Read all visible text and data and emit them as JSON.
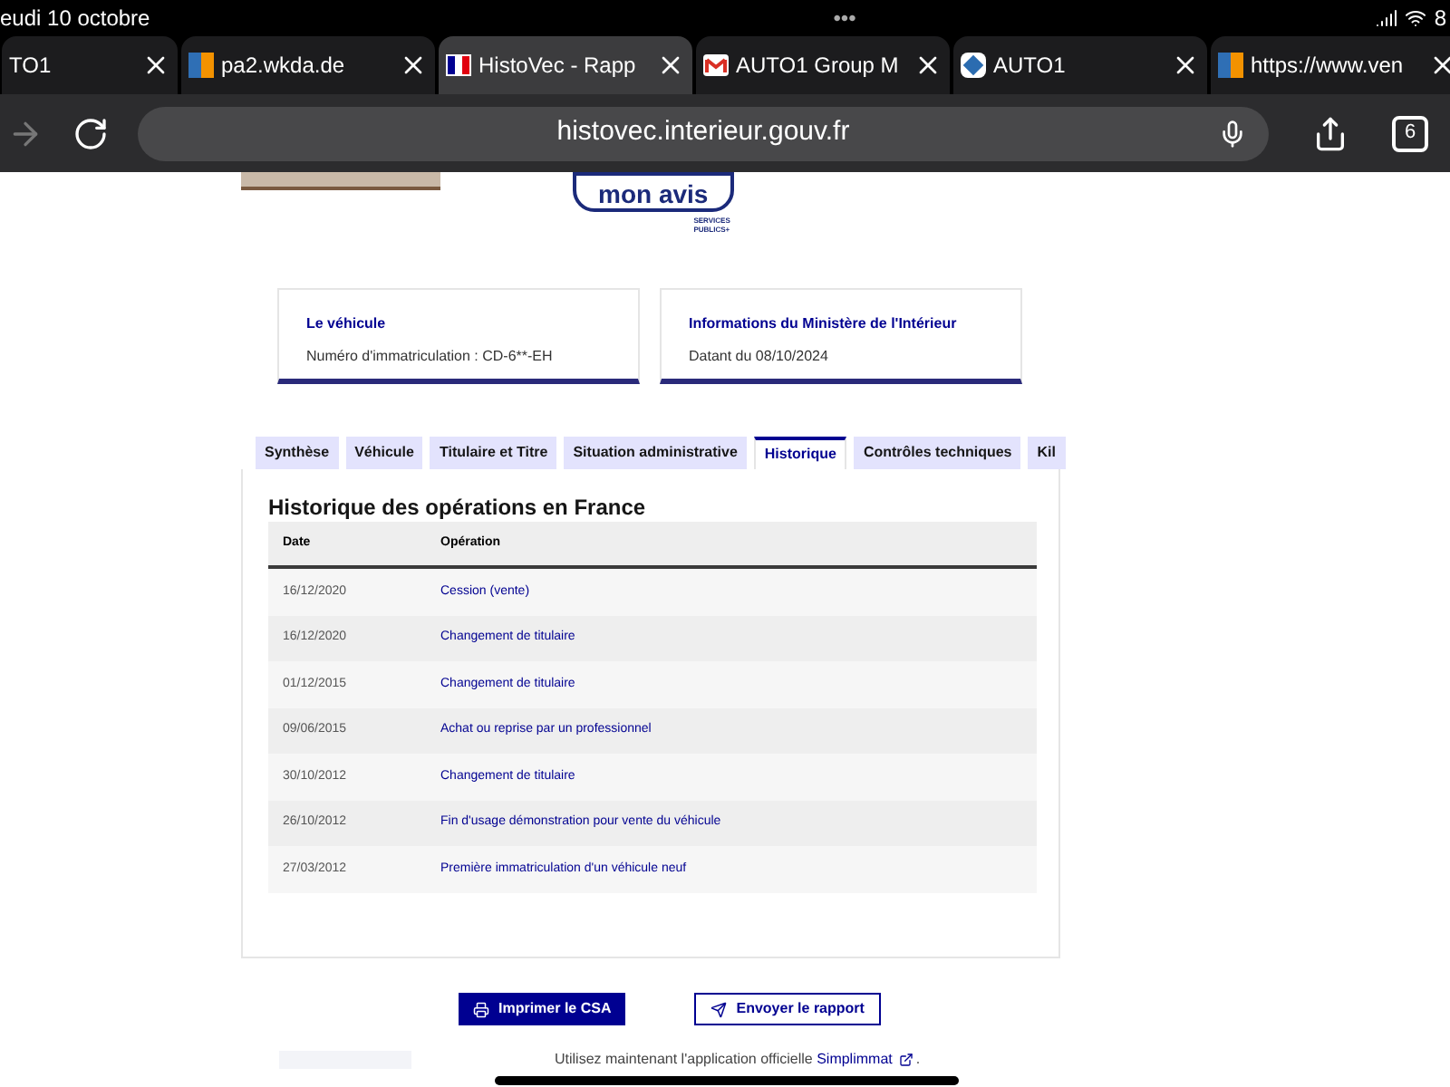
{
  "status_bar": {
    "date": "eudi 10 octobre",
    "dots": "•••",
    "battery": "8"
  },
  "browser_tabs": [
    {
      "title": "TO1",
      "selected": false
    },
    {
      "title": "pa2.wkda.de",
      "selected": false
    },
    {
      "title": "HistoVec - Rapp",
      "selected": true
    },
    {
      "title": "AUTO1 Group M",
      "selected": false
    },
    {
      "title": "AUTO1",
      "selected": false
    },
    {
      "title": "https://www.ven",
      "selected": false
    }
  ],
  "toolbar": {
    "url": "histovec.interieur.gouv.fr",
    "tab_count": "6"
  },
  "feedback_badge": {
    "label": "mon avis",
    "brand": "SERVICES PUBLICS+"
  },
  "cards": [
    {
      "title": "Le véhicule",
      "text": "Numéro d'immatriculation : CD-6**-EH"
    },
    {
      "title": "Informations du Ministère de l'Intérieur",
      "text": "Datant du 08/10/2024"
    }
  ],
  "tabs": [
    {
      "label": "Synthèse",
      "selected": false
    },
    {
      "label": "Véhicule",
      "selected": false
    },
    {
      "label": "Titulaire et Titre",
      "selected": false
    },
    {
      "label": "Situation administrative",
      "selected": false
    },
    {
      "label": "Historique",
      "selected": true
    },
    {
      "label": "Contrôles techniques",
      "selected": false
    },
    {
      "label": "Kil",
      "selected": false
    }
  ],
  "section_title": "Historique des opérations en France",
  "table": {
    "columns": [
      "Date",
      "Opération"
    ],
    "rows": [
      [
        "16/12/2020",
        "Cession (vente)"
      ],
      [
        "16/12/2020",
        "Changement de titulaire"
      ],
      [
        "01/12/2015",
        "Changement de titulaire"
      ],
      [
        "09/06/2015",
        "Achat ou reprise par un professionnel"
      ],
      [
        "30/10/2012",
        "Changement de titulaire"
      ],
      [
        "26/10/2012",
        "Fin d'usage démonstration pour vente du véhicule"
      ],
      [
        "27/03/2012",
        "Première immatriculation d'un véhicule neuf"
      ]
    ]
  },
  "buttons": [
    {
      "label": "Imprimer le CSA",
      "kind": "primary"
    },
    {
      "label": "Envoyer le rapport",
      "kind": "secondary"
    }
  ],
  "footer": {
    "text": "Utilisez maintenant l'application officielle ",
    "link": "Simplimmat",
    "after": "."
  }
}
